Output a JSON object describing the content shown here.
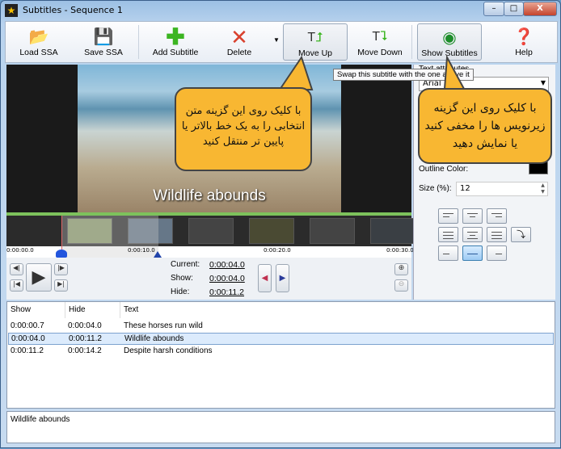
{
  "window": {
    "title": "Subtitles - Sequence 1",
    "minimize": "–",
    "maximize": "□",
    "close": "X"
  },
  "toolbar": {
    "load": "Load SSA",
    "save": "Save SSA",
    "add": "Add Subtitle",
    "delete": "Delete",
    "move_up": "Move Up",
    "move_down": "Move Down",
    "show_subtitles": "Show Subtitles",
    "help": "Help"
  },
  "tooltip": "Swap this subtitle with the one above it",
  "preview": {
    "subtitle": "Wildlife abounds"
  },
  "timeline": {
    "ticks": [
      "0:00:00.0",
      "0:00:10.0",
      "0:00:20.0",
      "0:00:30.0"
    ]
  },
  "times": {
    "current_label": "Current:",
    "current": "0:00:04.0",
    "show_label": "Show:",
    "show": "0:00:04.0",
    "hide_label": "Hide:",
    "hide": "0:00:11.2"
  },
  "attributes": {
    "section": "Text attributes",
    "font": "Arial",
    "outline_label": "Outline Color:",
    "size_label": "Size (%):",
    "size": "12"
  },
  "list": {
    "headers": [
      "Show",
      "Hide",
      "Text"
    ],
    "rows": [
      {
        "show": "0:00:00.7",
        "hide": "0:00:04.0",
        "text": "These horses run wild"
      },
      {
        "show": "0:00:04.0",
        "hide": "0:00:11.2",
        "text": "Wildlife abounds"
      },
      {
        "show": "0:00:11.2",
        "hide": "0:00:14.2",
        "text": "Despite harsh conditions"
      }
    ]
  },
  "editor": {
    "text": "Wildlife abounds"
  },
  "callouts": {
    "move_up": "با کلیک روی این گزینه متن انتخابی را به یک خط بالاتر یا پایین تر منتقل کنید",
    "show_subtitles": "با کلیک روی این گزینه زیرنویس ها را مخفی کنید یا نمایش دهید"
  },
  "colors": {
    "callout": "#f8b732",
    "accent": "#7dc25c",
    "selection": "#dcebfc"
  }
}
